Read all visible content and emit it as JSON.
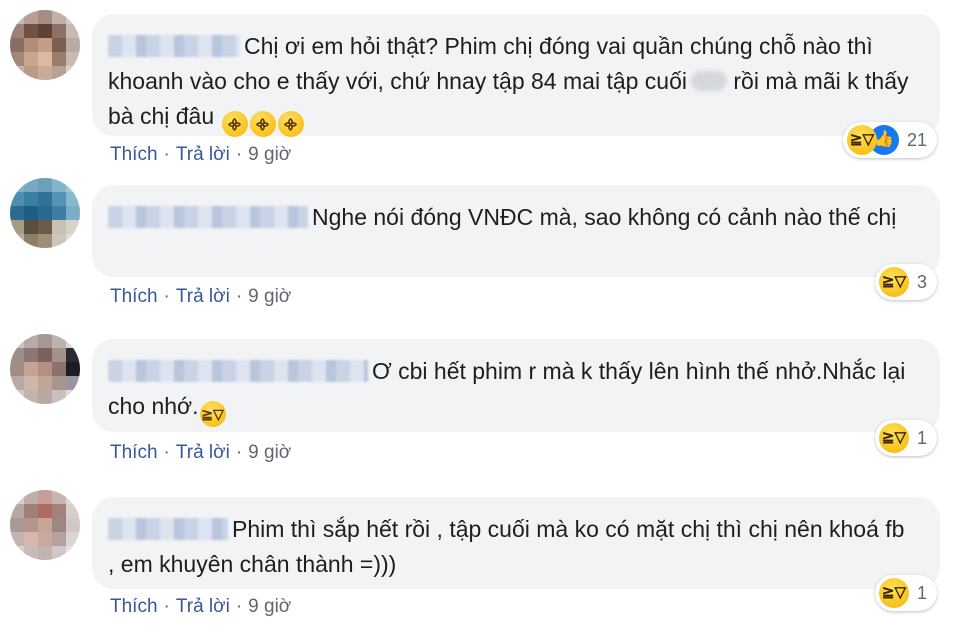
{
  "comments": [
    {
      "text": "Chị ơi em hỏi thật? Phim chị đóng vai quần chúng chỗ nào thì khoanh vào cho e thấy với, chứ hnay tập 84 mai tập cuối",
      "text_tail": "rồi mà mãi k thấy bà chị đâu",
      "reaction_count": "21",
      "like_label": "Thích",
      "reply_label": "Trả lời",
      "time": "9 giờ"
    },
    {
      "text": "Nghe nói đóng VNĐC mà, sao không có cảnh nào thế chị",
      "reaction_count": "3",
      "like_label": "Thích",
      "reply_label": "Trả lời",
      "time": "9 giờ"
    },
    {
      "text": "Ơ cbi hết phim r mà k thấy lên hình thế nhở.Nhắc lại cho nhớ.",
      "reaction_count": "1",
      "like_label": "Thích",
      "reply_label": "Trả lời",
      "time": "9 giờ"
    },
    {
      "text": "Phim thì sắp hết rồi , tập cuối mà ko có mặt chị thì chị nên khoá fb , em khuyên chân thành =)))",
      "reaction_count": "1",
      "like_label": "Thích",
      "reply_label": "Trả lời",
      "time": "9 giờ"
    }
  ],
  "colors": {
    "bubble": "#f2f3f5",
    "link": "#385898",
    "meta": "#606770",
    "like_blue": "#1877f2",
    "haha_yellow": "#f5b400"
  },
  "icons": [
    "avatar-pixelated",
    "haha-reaction-icon",
    "like-reaction-icon",
    "tired-face-emoji",
    "tears-of-joy-emoji"
  ]
}
